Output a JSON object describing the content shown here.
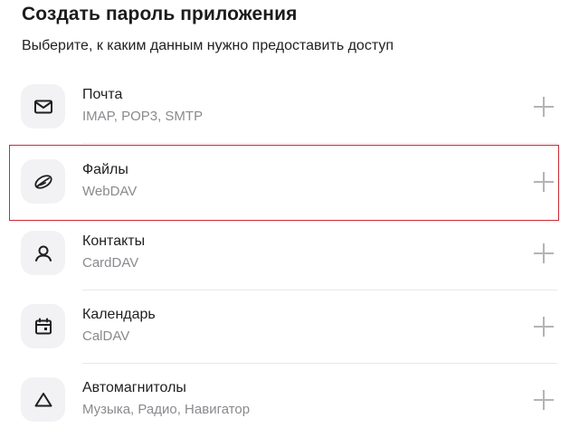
{
  "header": {
    "title": "Создать пароль приложения",
    "subtitle": "Выберите, к каким данным нужно предоставить доступ"
  },
  "items": [
    {
      "title": "Почта",
      "subtitle": "IMAP, POP3, SMTP",
      "icon": "mail-icon"
    },
    {
      "title": "Файлы",
      "subtitle": "WebDAV",
      "icon": "disk-icon"
    },
    {
      "title": "Контакты",
      "subtitle": "CardDAV",
      "icon": "contacts-icon"
    },
    {
      "title": "Календарь",
      "subtitle": "CalDAV",
      "icon": "calendar-icon"
    },
    {
      "title": "Автомагнитолы",
      "subtitle": "Музыка, Радио, Навигатор",
      "icon": "car-audio-icon"
    }
  ],
  "highlight_color": "#cc2a36"
}
